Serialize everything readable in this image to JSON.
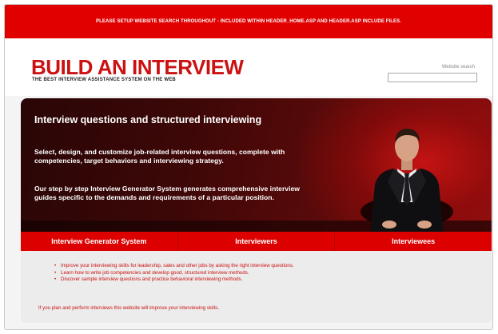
{
  "banner": {
    "text": "PLEASE SETUP WEBSITE SEARCH THROUGHOUT - INCLUDED WITHIN HEADER_HOME.ASP AND HEADER.ASP INCLUDE FILES."
  },
  "header": {
    "logo_title": "BUILD AN INTERVIEW",
    "logo_tagline": "THE BEST INTERVIEW ASSISTANCE SYSTEM ON THE WEB",
    "search_label": "Website search",
    "search_value": ""
  },
  "hero": {
    "title": "Interview questions and structured interviewing",
    "paragraph1": "Select, design, and customize job-related interview questions, complete with competencies, target behaviors and interviewing strategy.",
    "paragraph2": "Our step by step Interview Generator System generates comprehensive interview guides specific to the demands and requirements of a particular position."
  },
  "tabs": [
    {
      "label": "Interview Generator System"
    },
    {
      "label": "Interviewers"
    },
    {
      "label": "Interviewees"
    }
  ],
  "content": {
    "bullets": [
      "Improve your interviewing skills for leadership, sales and other jobs by asking the right interview questions.",
      "Learn how to write job competencies and develop good, structured interview methods.",
      "Discover sample interview questions and practice behavioral interviewing methods."
    ],
    "closing": "If you plan and perform interviews this website will improve your interviewing skills."
  },
  "colors": {
    "brand_red": "#e00000",
    "logo_red": "#cc1111",
    "hero_dark": "#3d0707"
  }
}
